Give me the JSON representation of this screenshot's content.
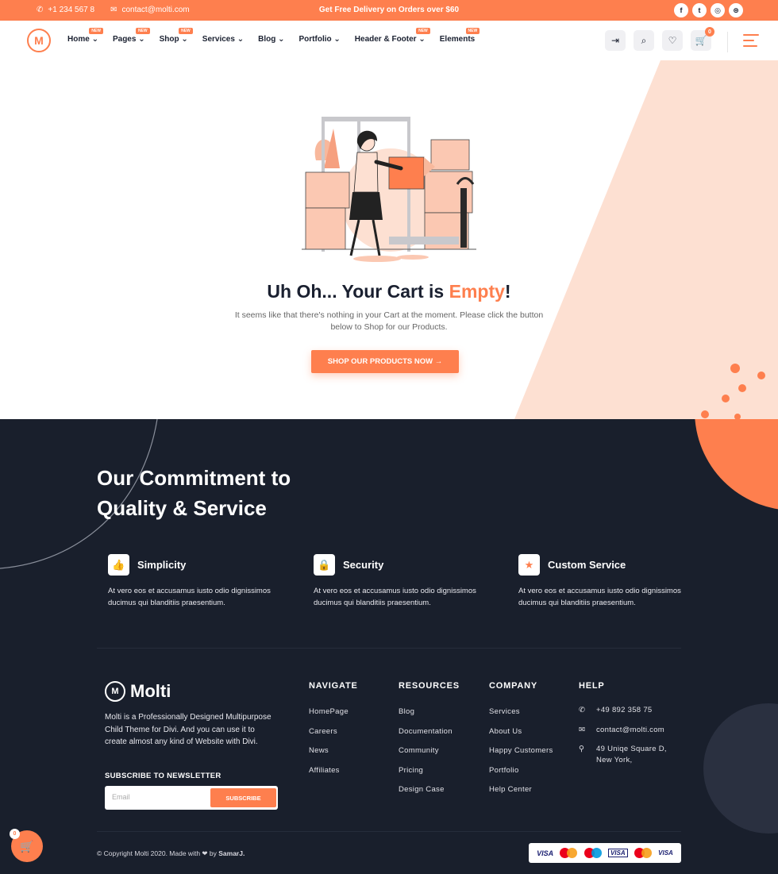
{
  "topbar": {
    "phone": "+1 234 567 8",
    "email": "contact@molti.com",
    "promo": "Get Free Delivery on Orders over $60",
    "social": [
      "facebook-icon",
      "twitter-icon",
      "instagram-icon",
      "dribbble-icon"
    ],
    "social_glyphs": [
      "f",
      "t",
      "◎",
      "⊛"
    ]
  },
  "nav": {
    "logo_letter": "M",
    "items": [
      {
        "label": "Home",
        "badge": "NEW"
      },
      {
        "label": "Pages",
        "badge": "NEW"
      },
      {
        "label": "Shop",
        "badge": "NEW"
      },
      {
        "label": "Services",
        "badge": ""
      },
      {
        "label": "Blog",
        "badge": ""
      },
      {
        "label": "Portfolio",
        "badge": ""
      },
      {
        "label": "Header & Footer",
        "badge": "NEW"
      },
      {
        "label": "Elements",
        "badge": "NEW"
      }
    ],
    "cart_count": "0"
  },
  "empty_cart": {
    "title_prefix": "Uh Oh... Your Cart is ",
    "title_accent": "Empty",
    "title_suffix": "!",
    "description": "It seems like that there's nothing in your Cart at the moment. Please click the button below to Shop for our Products.",
    "button_label": "SHOP OUR PRODUCTS NOW →"
  },
  "commitment": {
    "title_line1": "Our Commitment to",
    "title_line2": "Quality & Service",
    "features": [
      {
        "icon": "thumbs-up-icon",
        "title": "Simplicity",
        "desc": "At vero eos et accusamus iusto odio dignissimos ducimus qui blanditiis praesentium."
      },
      {
        "icon": "lock-icon",
        "title": "Security",
        "desc": "At vero eos et accusamus iusto odio dignissimos ducimus qui blanditiis praesentium."
      },
      {
        "icon": "star-icon",
        "title": "Custom Service",
        "desc": "At vero eos et accusamus iusto odio dignissimos ducimus qui blanditiis praesentium."
      }
    ]
  },
  "footer": {
    "brand": "Molti",
    "about": "Molti is a Professionally Designed Multipurpose Child Theme for Divi. And you can use it to create almost any kind of Website with Divi.",
    "subscribe_title": "SUBSCRIBE TO NEWSLETTER",
    "subscribe_placeholder": "Email",
    "subscribe_button": "SUBSCRIBE",
    "columns": [
      {
        "heading": "NAVIGATE",
        "items": [
          "HomePage",
          "Careers",
          "News",
          "Affiliates"
        ]
      },
      {
        "heading": "RESOURCES",
        "items": [
          "Blog",
          "Documentation",
          "Community",
          "Pricing",
          "Design Case"
        ]
      },
      {
        "heading": "COMPANY",
        "items": [
          "Services",
          "About Us",
          "Happy Customers",
          "Portfolio",
          "Help Center"
        ]
      }
    ],
    "help": {
      "heading": "HELP",
      "phone": "+49 892 358 75",
      "email": "contact@molti.com",
      "address": "49 Uniqe Square D, New York,"
    },
    "copyright_prefix": "© Copyright Molti 2020. Made with ❤ by ",
    "copyright_author": "SamarJ.",
    "payments": [
      "VISA",
      "mastercard",
      "maestro",
      "VISA",
      "mastercard",
      "VISA"
    ],
    "float_cart_count": "0"
  },
  "colors": {
    "accent": "#fe7f4e",
    "dark": "#191f2c",
    "peach": "#fde0d2"
  }
}
